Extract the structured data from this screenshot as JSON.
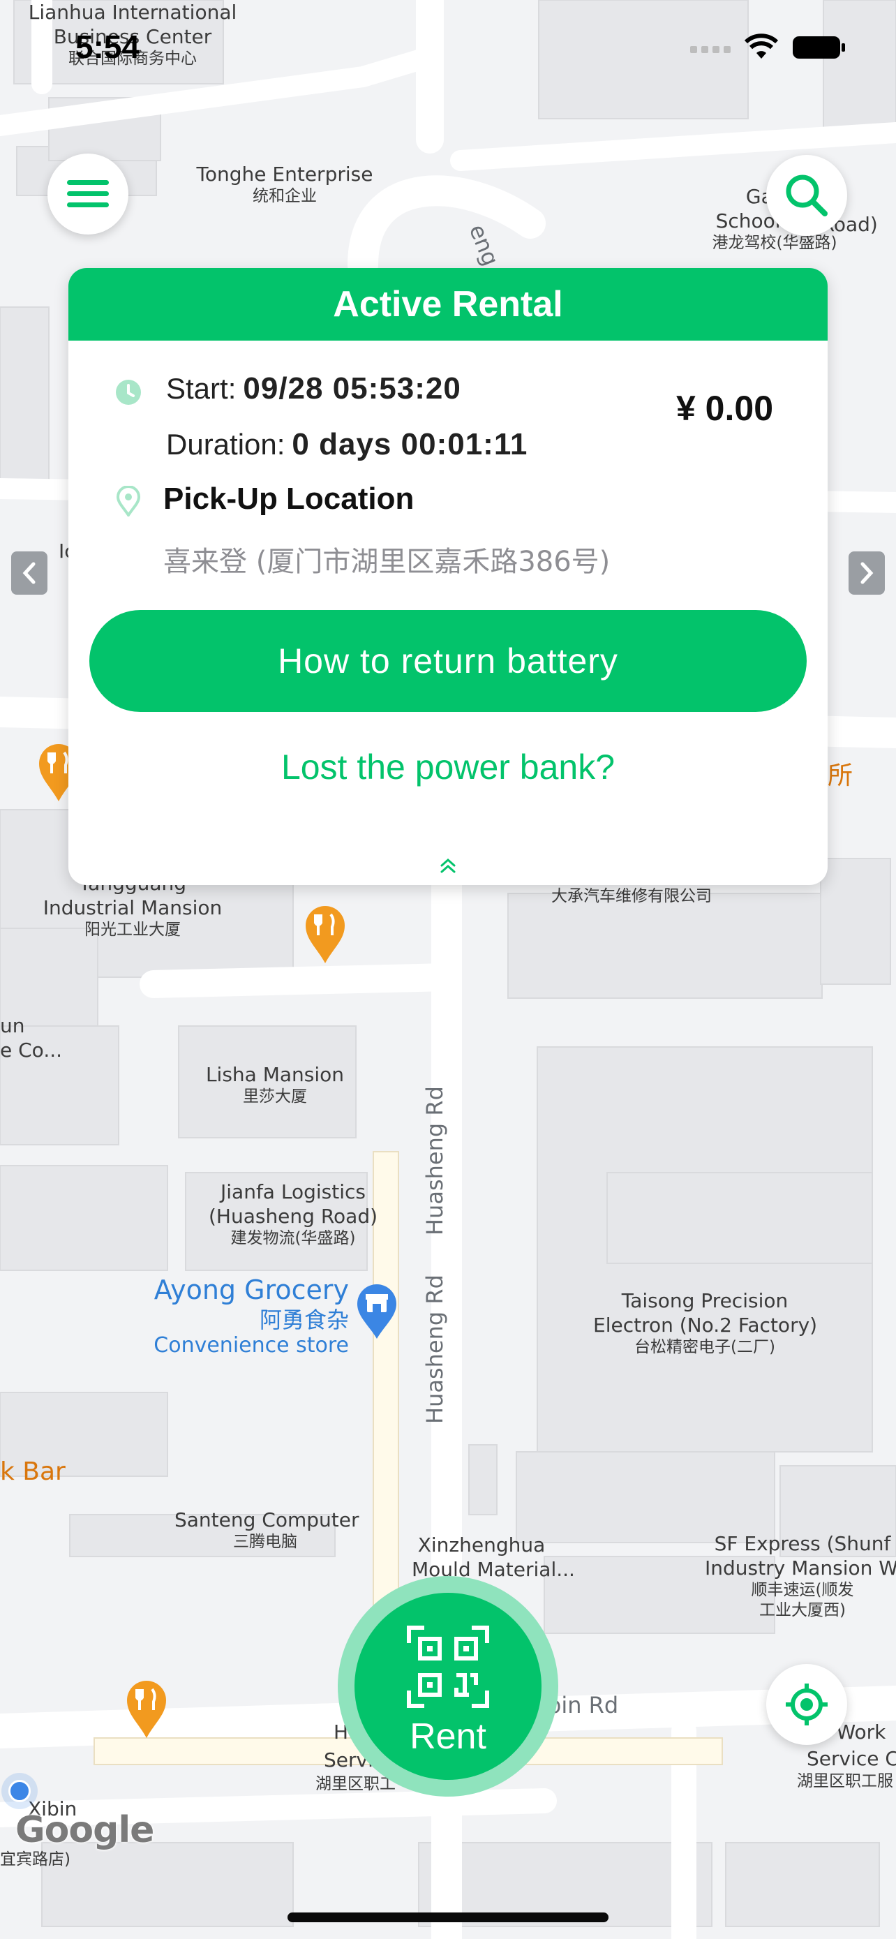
{
  "status_bar": {
    "time": "5:54"
  },
  "colors": {
    "accent": "#03c36b",
    "accent_light": "#8fe3bd",
    "map_bg": "#f2f3f5",
    "poi_blue": "#2f7fd6",
    "poi_orange": "#f29a1f"
  },
  "icons": {
    "menu": "menu-icon",
    "search": "search-icon",
    "locate": "crosshair-icon",
    "rent": "qr-code-icon",
    "clock": "clock-icon",
    "pin": "location-pin-icon"
  },
  "card": {
    "title": "Active Rental",
    "start_label": "Start:",
    "start_value": "09/28 05:53:20",
    "duration_label": "Duration:",
    "duration_value": "0 days 00:01:11",
    "price": "¥ 0.00",
    "pickup_title": "Pick-Up Location",
    "pickup_address": "喜来登 (厦门市湖里区嘉禾路386号)",
    "return_button": "How to return battery",
    "lost_link": "Lost the power bank?"
  },
  "rent_button": {
    "label": "Rent"
  },
  "map": {
    "labels": [
      {
        "en": "Lianhua International",
        "en2": "Business Center",
        "zh": "联合国际商务中心"
      },
      {
        "en": "Tonghe Enterprise",
        "zh": "统和企业"
      },
      {
        "en": "Gangl",
        "en2": "School (Hua",
        "zh": "港龙驾校(华盛路)"
      },
      {
        "en": "Yangguang",
        "en2": "Industrial Mansion",
        "zh": "阳光工业大厦"
      },
      {
        "en": "Lisha Mansion",
        "zh": "里莎大厦"
      },
      {
        "en": "Jianfa Logistics",
        "en2": "(Huasheng Road)",
        "zh": "建发物流(华盛路)"
      },
      {
        "en": "Taisong Precision",
        "en2": "Electron (No.2 Factory)",
        "zh": "台松精密电子(二厂)"
      },
      {
        "en": "Santeng Computer",
        "zh": "三腾电脑"
      },
      {
        "en": "Xinzhenghua",
        "en2": "Mould Material..."
      },
      {
        "en": "SF Express (Shunf",
        "en2": "Industry Mansion We",
        "zh": "顺丰速运(顺发",
        "zh2": "工业大厦西)"
      },
      {
        "zh": "大承汽车维修有限公司"
      },
      {
        "en": "g Road)"
      },
      {
        "en": "un",
        "en2": "e Co..."
      }
    ],
    "roads": [
      "Huasheng Rd",
      "Huasheng Rd",
      "eng Rd",
      "bin Rd"
    ],
    "grocery": {
      "name": "Ayong Grocery",
      "zh": "阿勇食杂",
      "type": "Convenience store"
    },
    "orange_text": [
      "k Bar",
      "所"
    ],
    "attribution": "Google",
    "misc": [
      "Ic",
      "Xibin",
      "宜宾路店)",
      "H",
      "Servi",
      "湖里区职工",
      "li Work",
      "Service Ce",
      "湖里区职工服"
    ]
  }
}
